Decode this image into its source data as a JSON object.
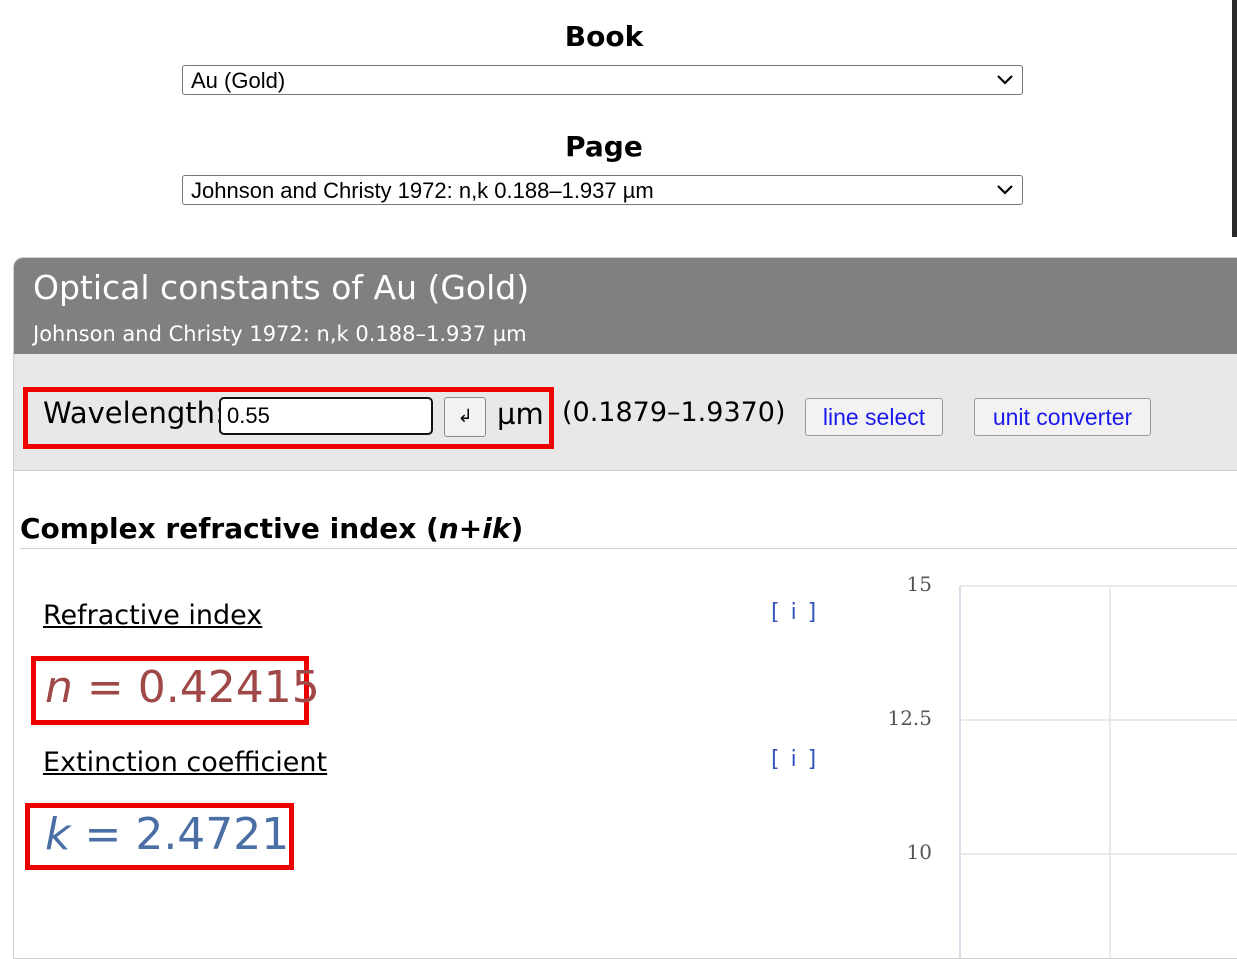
{
  "book": {
    "label": "Book",
    "selected": "Au (Gold)"
  },
  "page": {
    "label": "Page",
    "selected": "Johnson and Christy 1972: n,k 0.188–1.937 µm"
  },
  "panel": {
    "title": "Optical constants of Au (Gold)",
    "subtitle": "Johnson and Christy 1972: n,k 0.188–1.937 µm"
  },
  "wavelength": {
    "label": "Wavelength:",
    "value": "0.55",
    "enter_symbol": "↲",
    "unit": "µm",
    "range": "(0.1879–1.9370)",
    "line_select": "line select",
    "unit_converter": "unit converter"
  },
  "cri": {
    "title": "Complex refractive index (",
    "title_var": "n+ik",
    "title_end": ")"
  },
  "refractive": {
    "label": "Refractive index",
    "info": "[ i ]",
    "var": "n",
    "eq": " = 0.42415"
  },
  "extinction": {
    "label": "Extinction coefficient",
    "info": "[ i ]",
    "var": "k",
    "eq": " = 2.4721"
  },
  "chart_data": {
    "type": "line",
    "yticks": [
      "15",
      "12.5",
      "10"
    ],
    "y_values": [
      15,
      12.5,
      10
    ],
    "grid": true
  },
  "colors": {
    "highlight": "#ee0000",
    "n_color": "#a04848",
    "k_color": "#4a6fa5",
    "header_bg": "#808080"
  }
}
